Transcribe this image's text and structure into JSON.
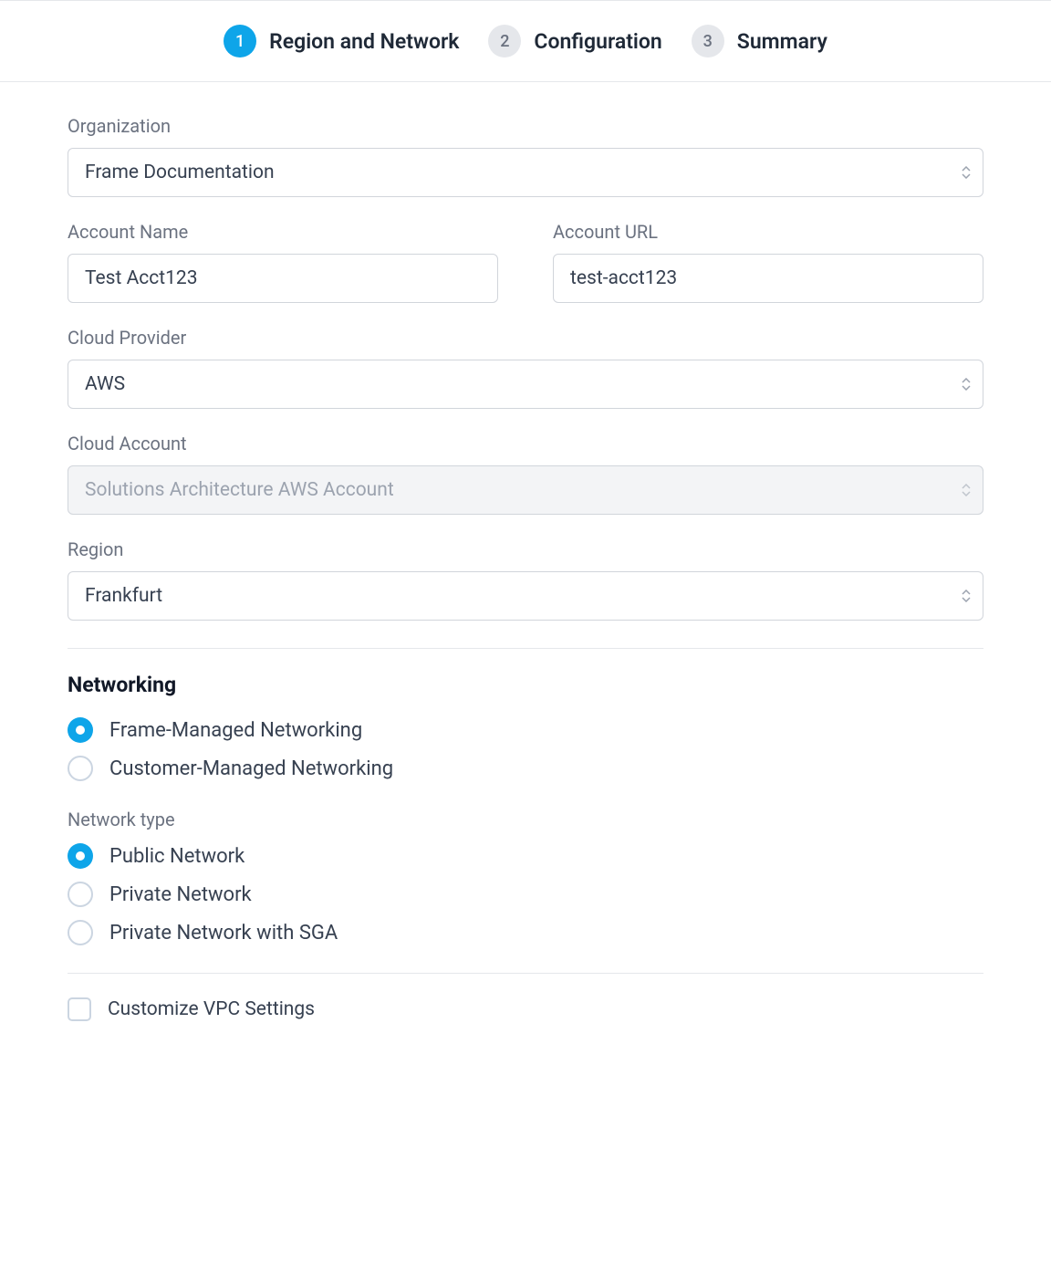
{
  "stepper": {
    "steps": [
      {
        "num": "1",
        "label": "Region and Network",
        "active": true
      },
      {
        "num": "2",
        "label": "Configuration",
        "active": false
      },
      {
        "num": "3",
        "label": "Summary",
        "active": false
      }
    ]
  },
  "form": {
    "organization": {
      "label": "Organization",
      "value": "Frame Documentation"
    },
    "accountName": {
      "label": "Account Name",
      "value": "Test Acct123"
    },
    "accountUrl": {
      "label": "Account URL",
      "value": "test-acct123"
    },
    "cloudProvider": {
      "label": "Cloud Provider",
      "value": "AWS"
    },
    "cloudAccount": {
      "label": "Cloud Account",
      "value": "Solutions Architecture AWS Account"
    },
    "region": {
      "label": "Region",
      "value": "Frankfurt"
    }
  },
  "networking": {
    "title": "Networking",
    "mode": {
      "options": [
        {
          "label": "Frame-Managed Networking",
          "selected": true
        },
        {
          "label": "Customer-Managed Networking",
          "selected": false
        }
      ]
    },
    "networkType": {
      "label": "Network type",
      "options": [
        {
          "label": "Public Network",
          "selected": true
        },
        {
          "label": "Private Network",
          "selected": false
        },
        {
          "label": "Private Network with SGA",
          "selected": false
        }
      ]
    },
    "customizeVpc": {
      "label": "Customize VPC Settings",
      "checked": false
    }
  }
}
